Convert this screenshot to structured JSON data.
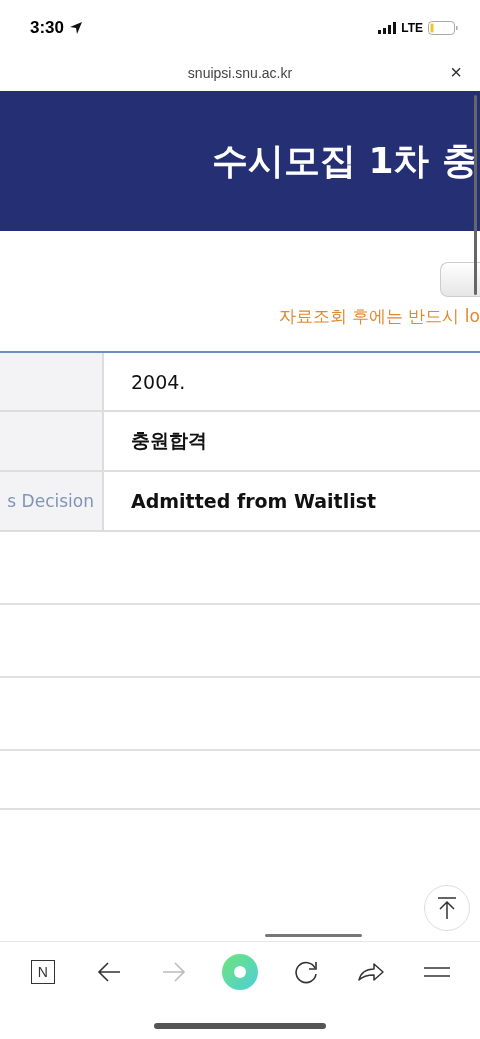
{
  "status_bar": {
    "time": "3:30",
    "network": "LTE"
  },
  "url_bar": {
    "address": "snuipsi.snu.ac.kr",
    "close": "×"
  },
  "banner": {
    "title": "수시모집 1차 충"
  },
  "notice": "자료조회 후에는 반드시 lo",
  "table": {
    "rows": [
      {
        "value": "2004.",
        "bold": false
      },
      {
        "value": "충원합격",
        "bold": true
      },
      {
        "label": "s Decision",
        "value": "Admitted from Waitlist",
        "bold": true
      }
    ]
  },
  "toolbar": {
    "items": [
      {
        "kind": "home",
        "text": "N",
        "disabled": false
      },
      {
        "kind": "back",
        "disabled": false
      },
      {
        "kind": "forward",
        "disabled": true
      },
      {
        "kind": "green",
        "disabled": false
      },
      {
        "kind": "reload",
        "disabled": false
      },
      {
        "kind": "share",
        "disabled": false
      },
      {
        "kind": "menu",
        "disabled": false
      }
    ]
  }
}
